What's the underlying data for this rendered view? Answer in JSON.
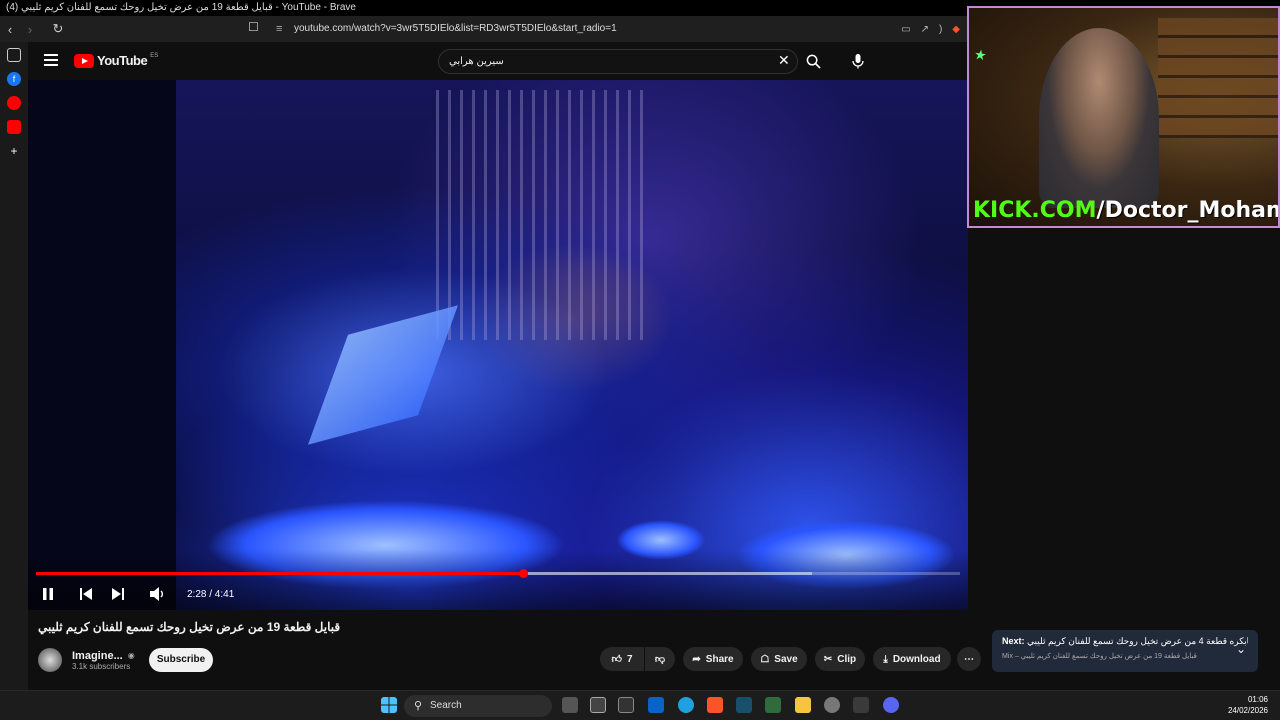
{
  "window": {
    "title": "(4) قبايل قطعة 19 من عرض تخيل روحك تسمع للفنان كريم ثليبي - YouTube - Brave"
  },
  "browser": {
    "url": "youtube.com/watch?v=3wr5T5DIElo&list=RD3wr5T5DIElo&start_radio=1"
  },
  "youtube": {
    "logo_text": "YouTube",
    "country_code": "ES",
    "search_value": "سيرين هرابي"
  },
  "player": {
    "current_time": "2:28",
    "duration": "4:41",
    "time_display": "2:28 / 4:41",
    "progress_fraction": 0.527,
    "buffered_fraction": 0.84,
    "watermark": "imagine",
    "state": "playing"
  },
  "overlay": {
    "kick_part": "KICK.COM",
    "handle_part": "/Doctor_Mohamed"
  },
  "video_info": {
    "title": "قبايل قطعة 19 من عرض تخيل روحك تسمع للفنان كريم ثليبي",
    "channel_name": "Imagine...",
    "subscribers": "3.1k subscribers",
    "subscribe_label": "Subscribe",
    "like_count": "7",
    "share_label": "Share",
    "save_label": "Save",
    "clip_label": "Clip",
    "download_label": "Download"
  },
  "next_card": {
    "label": "Next:",
    "line1": "يابكره قطعة 4 من عرض تخيل روحك تسمع للفنان كريم ثليبي ...",
    "line2": "Mix – قبايل قطعة 19 من عرض تخيل روحك تسمع للفنان كريم ثليبي"
  },
  "taskbar": {
    "search_label": "Search",
    "time": "01:06",
    "date": "24/02/2026"
  },
  "colors": {
    "brand": "#ff0000",
    "kick": "#53fc18",
    "background": "#0f0f0f"
  }
}
